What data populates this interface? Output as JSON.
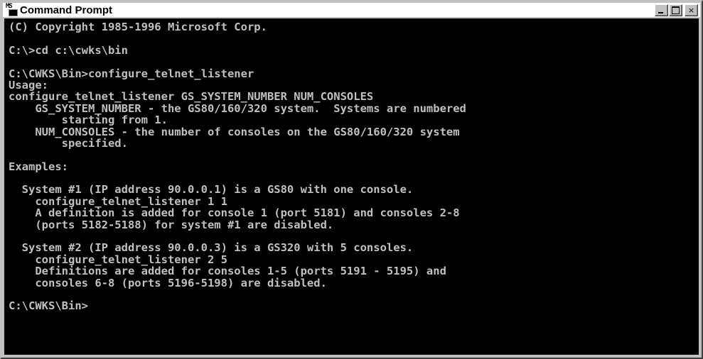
{
  "window": {
    "title": "Command Prompt",
    "icon": "ms-dos-prompt-icon",
    "controls": {
      "minimize": "minimize",
      "maximize": "maximize",
      "close": "×"
    }
  },
  "console": {
    "lines": [
      "(C) Copyright 1985-1996 Microsoft Corp.",
      "",
      "C:\\>cd c:\\cwks\\bin",
      "",
      "C:\\CWKS\\Bin>configure_telnet_listener",
      "Usage:",
      "configure_telnet_listener GS_SYSTEM_NUMBER NUM_CONSOLES",
      "    GS_SYSTEM_NUMBER - the GS80/160/320 system.  Systems are numbered",
      "        starting from 1.",
      "    NUM_CONSOLES - the number of consoles on the GS80/160/320 system",
      "        specified.",
      "",
      "Examples:",
      "",
      "  System #1 (IP address 90.0.0.1) is a GS80 with one console.",
      "    configure_telnet_listener 1 1",
      "    A definition is added for console 1 (port 5181) and consoles 2-8",
      "    (ports 5182-5188) for system #1 are disabled.",
      "",
      "  System #2 (IP address 90.0.0.3) is a GS320 with 5 consoles.",
      "    configure_telnet_listener 2 5",
      "    Definitions are added for consoles 1-5 (ports 5191 - 5195) and",
      "    consoles 6-8 (ports 5196-5198) are disabled.",
      "",
      "C:\\CWKS\\Bin>"
    ]
  },
  "colors": {
    "console_background": "#000000",
    "console_text": "#c0c0c0",
    "chrome": "#c0c0c0"
  }
}
